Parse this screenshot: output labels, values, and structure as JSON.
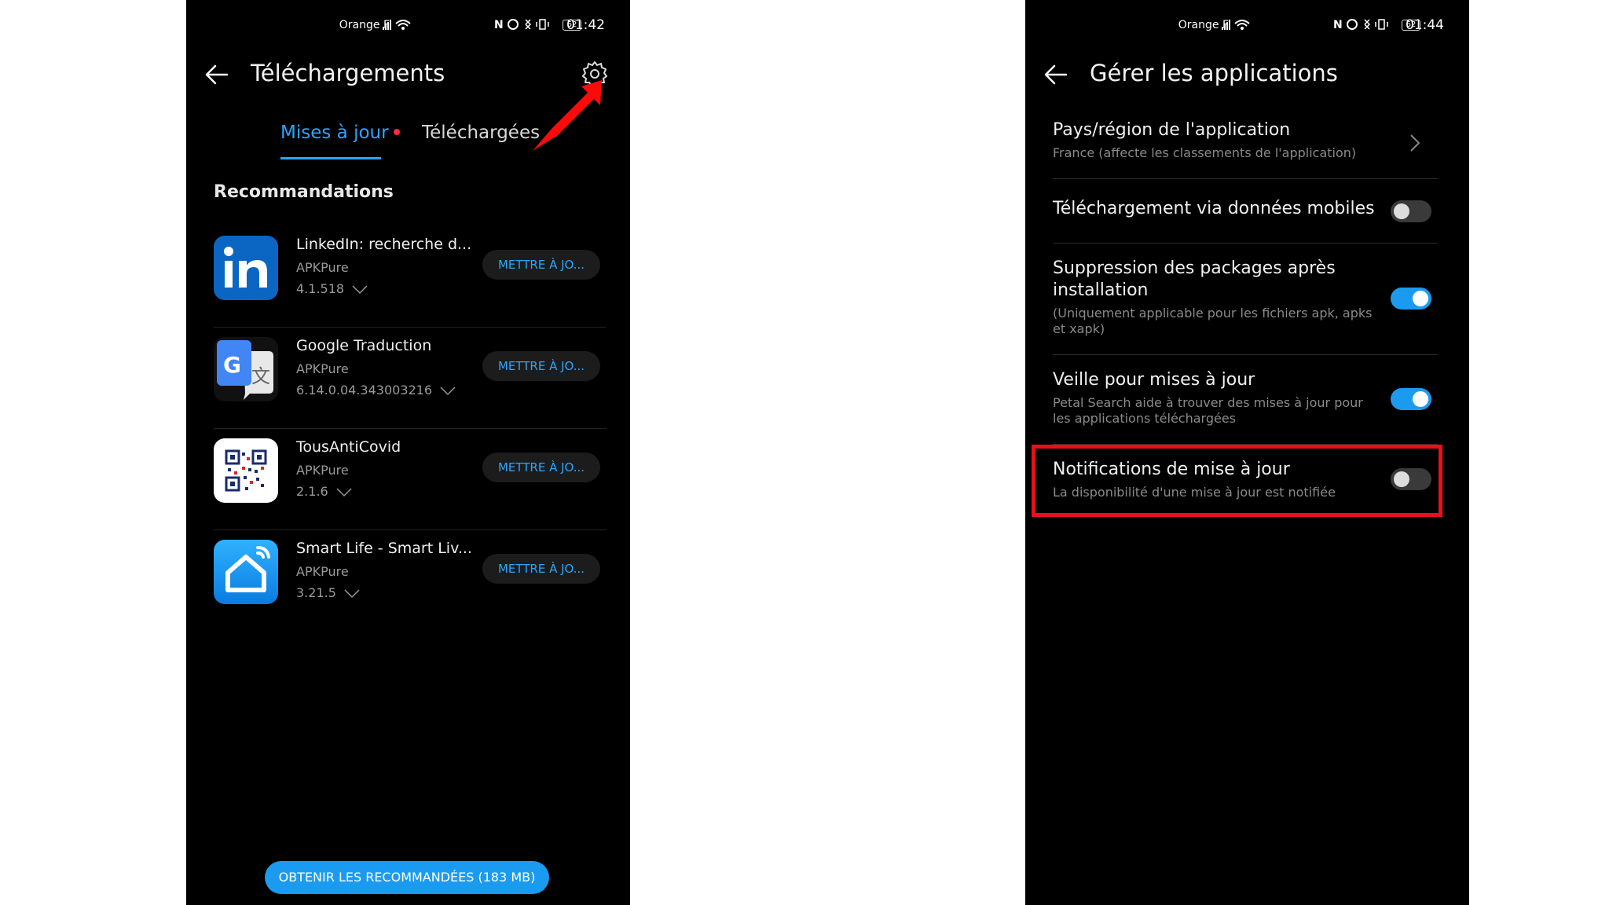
{
  "colors": {
    "accent": "#2aa6ff",
    "toggle_on": "#1a9bf0",
    "highlight": "#e8101b",
    "badge_dot": "#ff2a44"
  },
  "left": {
    "status": {
      "carrier": "Orange F",
      "time": "01:42",
      "battery": "62"
    },
    "header": {
      "title": "Téléchargements",
      "back_icon": "arrow-left-icon",
      "gear_icon": "gear-icon"
    },
    "tabs": [
      {
        "label": "Mises à jour",
        "active": true,
        "has_badge": true
      },
      {
        "label": "Téléchargées",
        "active": false
      }
    ],
    "section_title": "Recommandations",
    "apps": [
      {
        "name": "LinkedIn: recherche d...",
        "source": "APKPure",
        "version": "4.1.518",
        "button": "METTRE À JO..."
      },
      {
        "name": "Google Traduction",
        "source": "APKPure",
        "version": "6.14.0.04.343003216",
        "button": "METTRE À JO..."
      },
      {
        "name": "TousAntiCovid",
        "source": "APKPure",
        "version": "2.1.6",
        "button": "METTRE À JO..."
      },
      {
        "name": "Smart Life - Smart Liv...",
        "source": "APKPure",
        "version": "3.21.5",
        "button": "METTRE À JO..."
      }
    ],
    "bottom_button": "OBTENIR LES RECOMMANDÉES (183 MB)"
  },
  "right": {
    "status": {
      "carrier": "Orange F",
      "time": "01:44",
      "battery": "62"
    },
    "header": {
      "title": "Gérer les applications"
    },
    "settings": [
      {
        "title": "Pays/région de l'application",
        "desc": "France (affecte les classements de l'application)",
        "control": "chevron"
      },
      {
        "title": "Téléchargement via données mobiles",
        "desc": "",
        "control": "toggle",
        "on": false
      },
      {
        "title": "Suppression des packages après installation",
        "desc": "(Uniquement applicable pour les fichiers apk, apks et xapk)",
        "control": "toggle",
        "on": true
      },
      {
        "title": "Veille pour mises à jour",
        "desc": "Petal Search aide à trouver des mises à jour pour les applications téléchargées",
        "control": "toggle",
        "on": true
      },
      {
        "title": "Notifications de mise à jour",
        "desc": "La disponibilité d'une mise à jour est notifiée",
        "control": "toggle",
        "on": false
      }
    ]
  }
}
